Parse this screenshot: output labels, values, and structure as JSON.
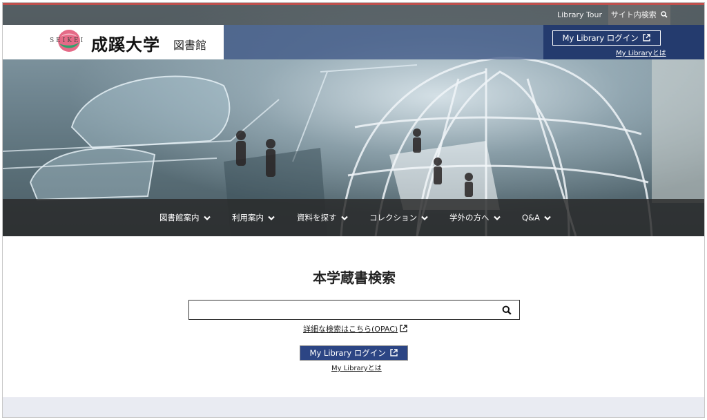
{
  "header": {
    "library_tour": "Library Tour",
    "site_search": "サイト内検索",
    "logo_roman": "SEIKEI",
    "logo_university": "成蹊大学",
    "logo_library": "図書館",
    "mylibrary_login": "My Library ログイン",
    "mylibrary_about": "My Libraryとは"
  },
  "nav": {
    "items": [
      {
        "label": "図書館案内"
      },
      {
        "label": "利用案内"
      },
      {
        "label": "資料を探す"
      },
      {
        "label": "コレクション"
      },
      {
        "label": "学外の方へ"
      },
      {
        "label": "Q&A"
      }
    ]
  },
  "search": {
    "title": "本学蔵書検索",
    "input_value": "",
    "input_placeholder": "",
    "opac_link": "詳細な検索はこちら(OPAC)",
    "mylibrary_login": "My Library ログイン",
    "mylibrary_about": "My Libraryとは"
  },
  "icons": {
    "site_search": "search-icon",
    "search_submit": "search-icon",
    "external_link": "external-link-icon",
    "nav_dropdown": "chevron-down-icon"
  },
  "colors": {
    "accent_red": "#c0504d",
    "brand_navy": "#243b6e",
    "button_blue": "#2c4584",
    "footer_bg": "#e9ebf2"
  }
}
